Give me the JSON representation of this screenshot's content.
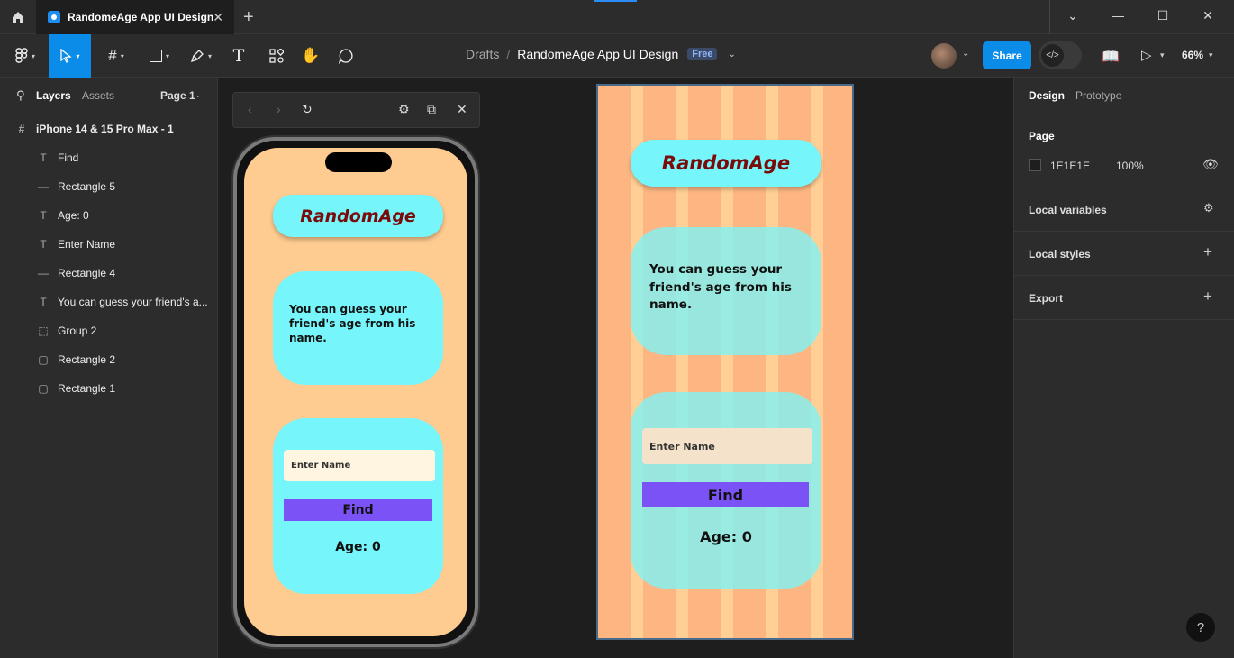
{
  "tab": {
    "title": "RandomeAge App UI Design"
  },
  "breadcrumb": {
    "drafts": "Drafts",
    "separator": "/",
    "file": "RandomeAge App UI Design",
    "plan_badge": "Free"
  },
  "toolbar": {
    "share_label": "Share",
    "zoom": "66%"
  },
  "left_panel": {
    "tabs": {
      "layers": "Layers",
      "assets": "Assets",
      "page": "Page 1"
    },
    "layers": [
      {
        "name": "iPhone 14 & 15 Pro Max - 1",
        "icon": "frame-icon"
      },
      {
        "name": "Find",
        "icon": "text-icon"
      },
      {
        "name": "Rectangle 5",
        "icon": "line-icon"
      },
      {
        "name": "Age: 0",
        "icon": "text-icon"
      },
      {
        "name": "Enter Name",
        "icon": "text-icon"
      },
      {
        "name": "Rectangle 4",
        "icon": "line-icon"
      },
      {
        "name": "You can guess your friend's a...",
        "icon": "text-icon"
      },
      {
        "name": "Group 2",
        "icon": "group-icon"
      },
      {
        "name": "Rectangle 2",
        "icon": "rectangle-icon"
      },
      {
        "name": "Rectangle 1",
        "icon": "rectangle-icon"
      }
    ]
  },
  "app": {
    "title": "RandomAge",
    "description_lines": [
      "You can guess your",
      "friend's age from his",
      "name."
    ],
    "input_placeholder": "Enter Name",
    "button_label": "Find",
    "age_label": "Age:",
    "age_value": "0"
  },
  "right_panel": {
    "tabs": {
      "design": "Design",
      "prototype": "Prototype"
    },
    "page_label": "Page",
    "page_color": "1E1E1E",
    "page_opacity": "100%",
    "local_variables": "Local variables",
    "local_styles": "Local styles",
    "export": "Export"
  },
  "colors": {
    "accent": "#0c8ce9",
    "screen_bg": "#fecb90",
    "card": "#76f5fb",
    "title_text": "#7a0b0b",
    "button": "#7b52f5"
  },
  "help": "?"
}
